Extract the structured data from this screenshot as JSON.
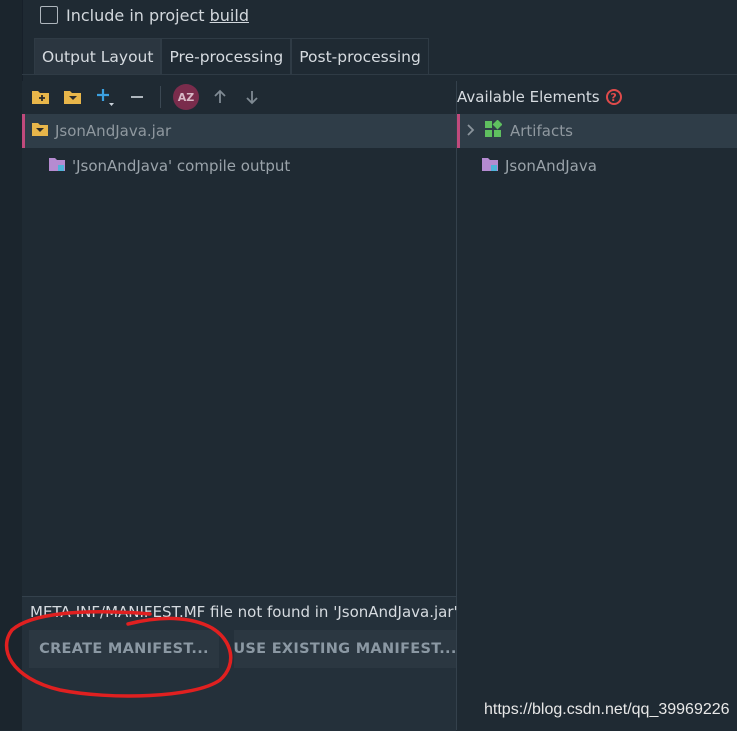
{
  "top": {
    "checkbox_label": "Include in project ",
    "checkbox_label_mnemonic": "build"
  },
  "tabs": [
    {
      "label": "Output Layout",
      "active": true
    },
    {
      "label": "Pre-processing",
      "active": false
    },
    {
      "label": "Post-processing",
      "active": false
    }
  ],
  "toolbar": {
    "icons": [
      "new-folder-icon",
      "archive-icon",
      "add-icon",
      "remove-icon",
      "sort-az-icon",
      "move-up-icon",
      "move-down-icon"
    ],
    "sort_label": "AZ"
  },
  "layout_tree": {
    "root": "JsonAndJava.jar",
    "child": "'JsonAndJava' compile output"
  },
  "available": {
    "header": "Available Elements",
    "help": "?",
    "items": [
      "Artifacts",
      "JsonAndJava"
    ]
  },
  "manifest": {
    "message": "META-INF/MANIFEST.MF file not found in 'JsonAndJava.jar'",
    "create_label": "CREATE MANIFEST...",
    "existing_label": "USE EXISTING MANIFEST..."
  },
  "watermark": "https://blog.csdn.net/qq_39969226",
  "colors": {
    "background": "#1f2a33",
    "selection": "#2f3d48",
    "accent": "#c04a7c",
    "annotation": "#e02020"
  }
}
